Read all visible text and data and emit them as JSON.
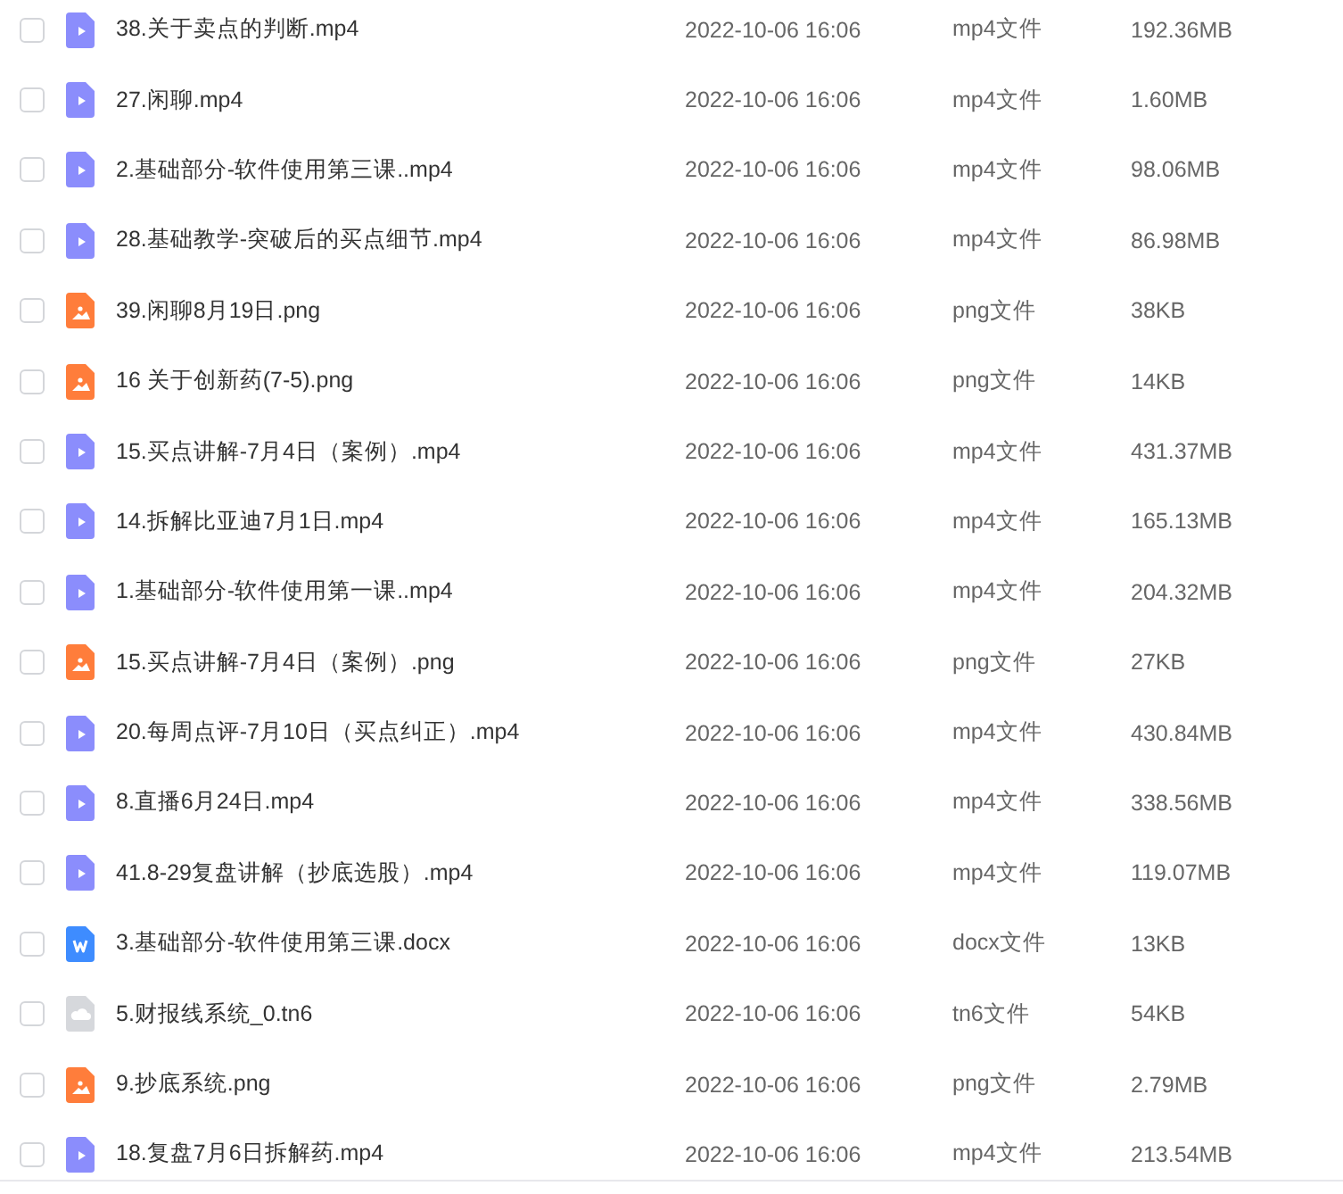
{
  "files": [
    {
      "kind": "video",
      "checked": false,
      "name": "38.关于卖点的判断.mp4",
      "modified": "2022-10-06 16:06",
      "type": "mp4文件",
      "size": "192.36MB"
    },
    {
      "kind": "video",
      "checked": false,
      "name": "27.闲聊.mp4",
      "modified": "2022-10-06 16:06",
      "type": "mp4文件",
      "size": "1.60MB"
    },
    {
      "kind": "video",
      "checked": false,
      "name": "2.基础部分-软件使用第三课..mp4",
      "modified": "2022-10-06 16:06",
      "type": "mp4文件",
      "size": "98.06MB"
    },
    {
      "kind": "video",
      "checked": false,
      "name": "28.基础教学-突破后的买点细节.mp4",
      "modified": "2022-10-06 16:06",
      "type": "mp4文件",
      "size": "86.98MB"
    },
    {
      "kind": "image",
      "checked": false,
      "name": "39.闲聊8月19日.png",
      "modified": "2022-10-06 16:06",
      "type": "png文件",
      "size": "38KB"
    },
    {
      "kind": "image",
      "checked": false,
      "name": "16 关于创新药(7-5).png",
      "modified": "2022-10-06 16:06",
      "type": "png文件",
      "size": "14KB"
    },
    {
      "kind": "video",
      "checked": false,
      "name": "15.买点讲解-7月4日（案例）.mp4",
      "modified": "2022-10-06 16:06",
      "type": "mp4文件",
      "size": "431.37MB"
    },
    {
      "kind": "video",
      "checked": false,
      "name": "14.拆解比亚迪7月1日.mp4",
      "modified": "2022-10-06 16:06",
      "type": "mp4文件",
      "size": "165.13MB"
    },
    {
      "kind": "video",
      "checked": false,
      "name": "1.基础部分-软件使用第一课..mp4",
      "modified": "2022-10-06 16:06",
      "type": "mp4文件",
      "size": "204.32MB"
    },
    {
      "kind": "image",
      "checked": false,
      "name": "15.买点讲解-7月4日（案例）.png",
      "modified": "2022-10-06 16:06",
      "type": "png文件",
      "size": "27KB"
    },
    {
      "kind": "video",
      "checked": false,
      "name": "20.每周点评-7月10日（买点纠正）.mp4",
      "modified": "2022-10-06 16:06",
      "type": "mp4文件",
      "size": "430.84MB"
    },
    {
      "kind": "video",
      "checked": false,
      "name": "8.直播6月24日.mp4",
      "modified": "2022-10-06 16:06",
      "type": "mp4文件",
      "size": "338.56MB"
    },
    {
      "kind": "video",
      "checked": false,
      "name": "41.8-29复盘讲解（抄底选股）.mp4",
      "modified": "2022-10-06 16:06",
      "type": "mp4文件",
      "size": "119.07MB"
    },
    {
      "kind": "word",
      "checked": false,
      "name": "3.基础部分-软件使用第三课.docx",
      "modified": "2022-10-06 16:06",
      "type": "docx文件",
      "size": "13KB"
    },
    {
      "kind": "cloud",
      "checked": false,
      "name": "5.财报线系统_0.tn6",
      "modified": "2022-10-06 16:06",
      "type": "tn6文件",
      "size": "54KB"
    },
    {
      "kind": "image",
      "checked": false,
      "name": "9.抄底系统.png",
      "modified": "2022-10-06 16:06",
      "type": "png文件",
      "size": "2.79MB"
    },
    {
      "kind": "video",
      "checked": false,
      "name": "18.复盘7月6日拆解药.mp4",
      "modified": "2022-10-06 16:06",
      "type": "mp4文件",
      "size": "213.54MB"
    }
  ]
}
